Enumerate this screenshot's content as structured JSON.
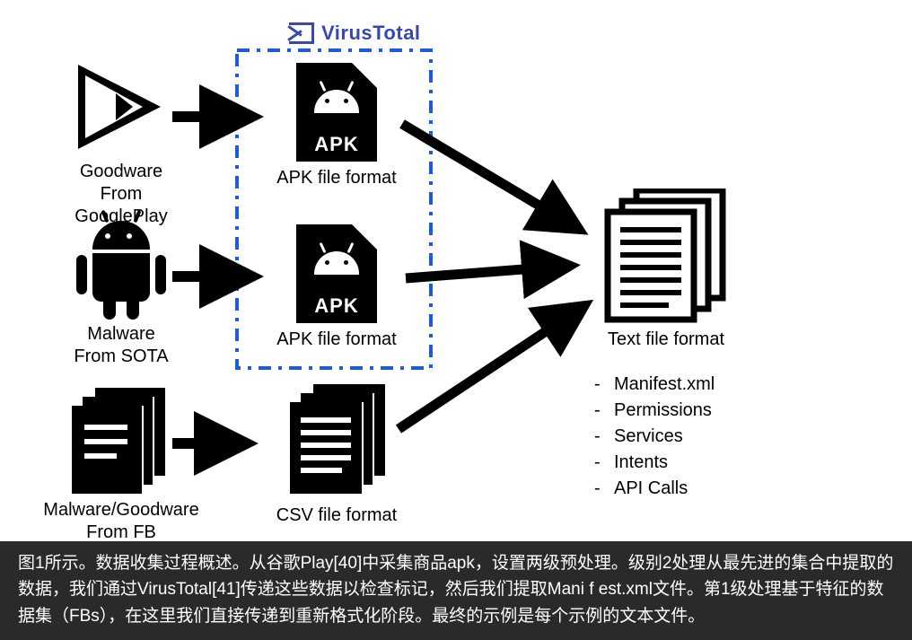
{
  "virustotal_label": "VirusTotal",
  "sources": {
    "googleplay": {
      "line1": "Goodware",
      "line2": "From GooglePlay"
    },
    "sota": {
      "line1": "Malware",
      "line2": "From SOTA"
    },
    "fb": {
      "line1": "Malware/Goodware",
      "line2": "From FB"
    }
  },
  "mids": {
    "apk1": "APK file format",
    "apk2": "APK file format",
    "csv": "CSV file format"
  },
  "output": {
    "title": "Text file format",
    "items": [
      "Manifest.xml",
      "Permissions",
      "Services",
      "Intents",
      "API Calls"
    ]
  },
  "caption": "图1所示。数据收集过程概述。从谷歌Play[40]中采集商品apk，设置两级预处理。级别2处理从最先进的集合中提取的数据，我们通过VirusTotal[41]传递这些数据以检查标记，然后我们提取Mani f est.xml文件。第1级处理基于特征的数据集（FBs），在这里我们直接传递到重新格式化阶段。最终的示例是每个示例的文本文件。"
}
